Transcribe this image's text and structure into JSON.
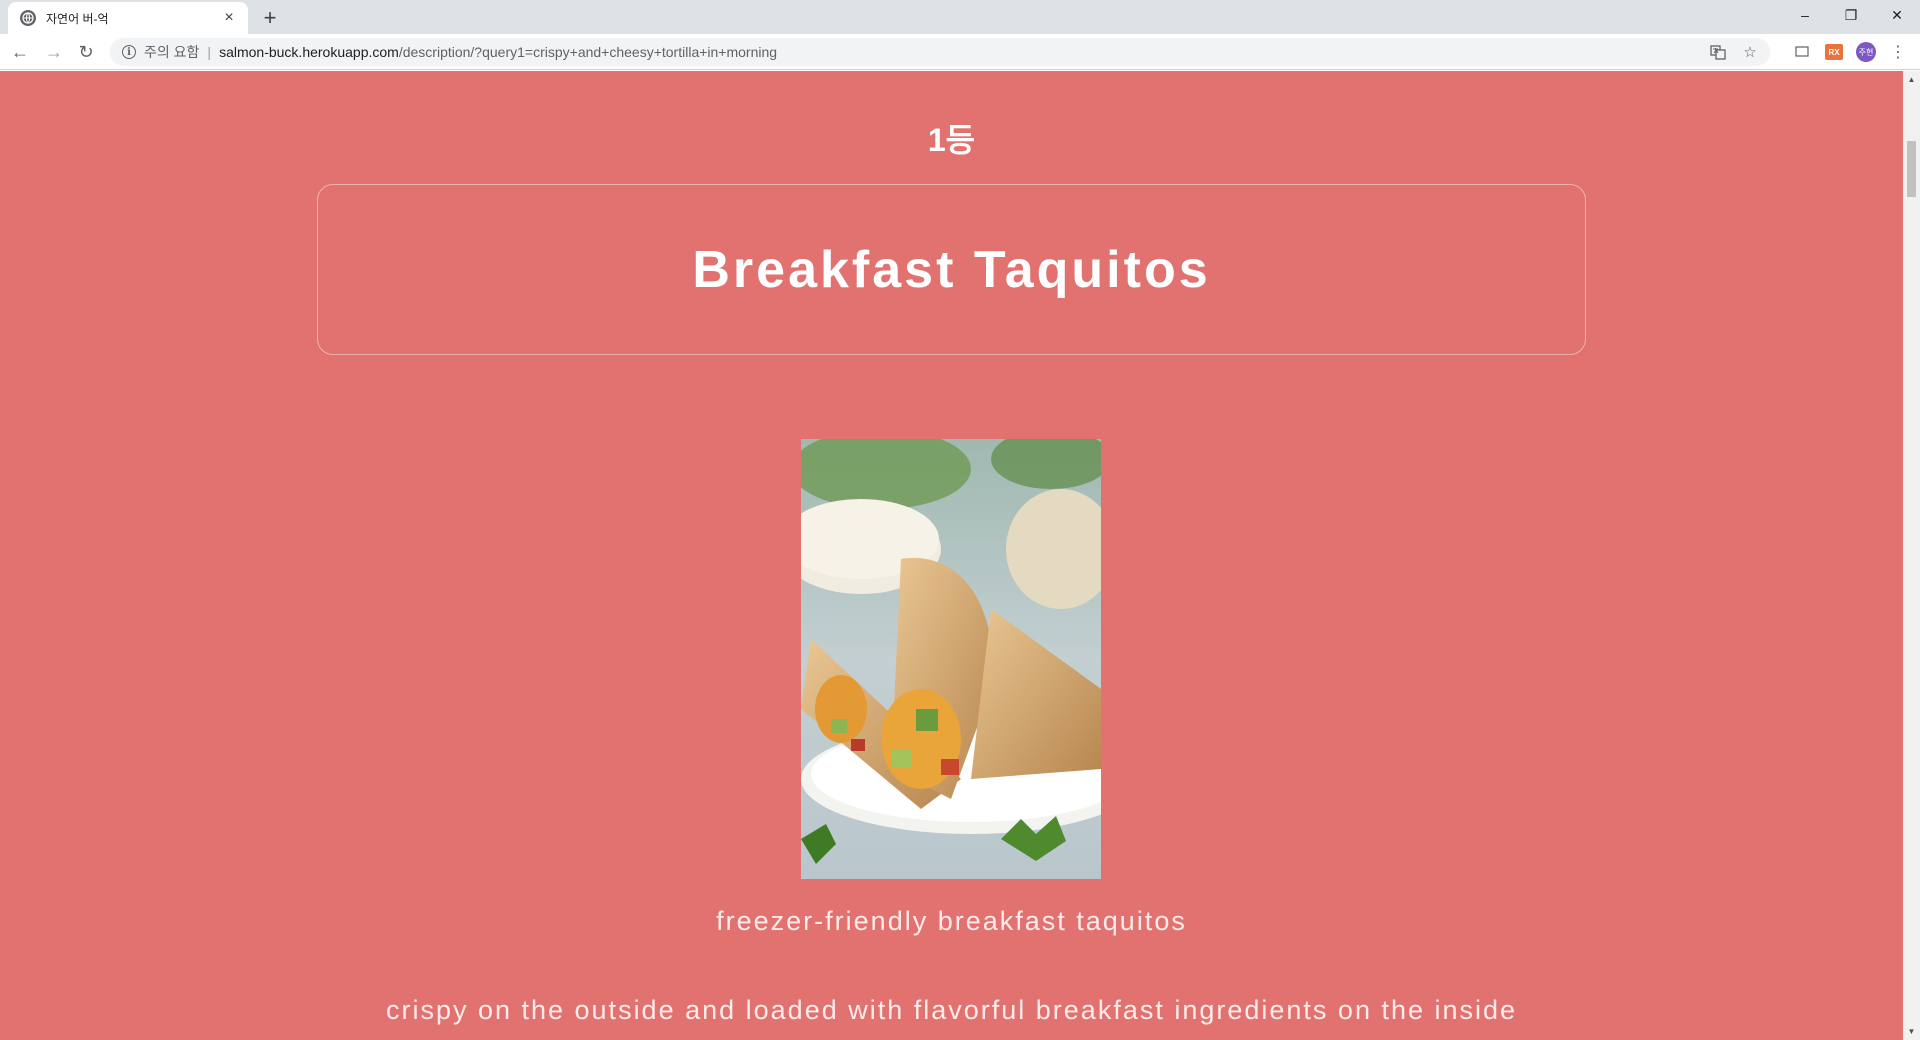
{
  "browser": {
    "tab": {
      "title": "자연어 버-억",
      "close": "×"
    },
    "new_tab": "+",
    "window": {
      "minimize": "–",
      "restore": "❐",
      "close": "✕"
    },
    "nav": {
      "back": "←",
      "forward": "→",
      "reload": "↻"
    },
    "omnibox": {
      "security_text": "주의 요함",
      "separator": "|",
      "url_host": "salmon-buck.herokuapp.com",
      "url_path": "/description/?query1=crispy+and+cheesy+tortilla+in+morning"
    },
    "profile_initials": "주현",
    "ext_badge": "RX"
  },
  "page": {
    "rank": "1등",
    "title": "Breakfast Taquitos",
    "image_alt": "breakfast taquitos on a plate",
    "caption": "freezer-friendly breakfast taquitos",
    "description": "crispy on the outside and loaded with flavorful breakfast ingredients on the inside"
  },
  "colors": {
    "page_background": "#e2726f",
    "text": "#ffffff",
    "tabstrip": "#dee1e6"
  },
  "icons": {
    "tab_favicon": "globe-icon",
    "info": "info-icon",
    "translate": "translate-icon",
    "bookmark": "star-icon",
    "cast": "cast-icon",
    "menu": "kebab-menu-icon"
  }
}
